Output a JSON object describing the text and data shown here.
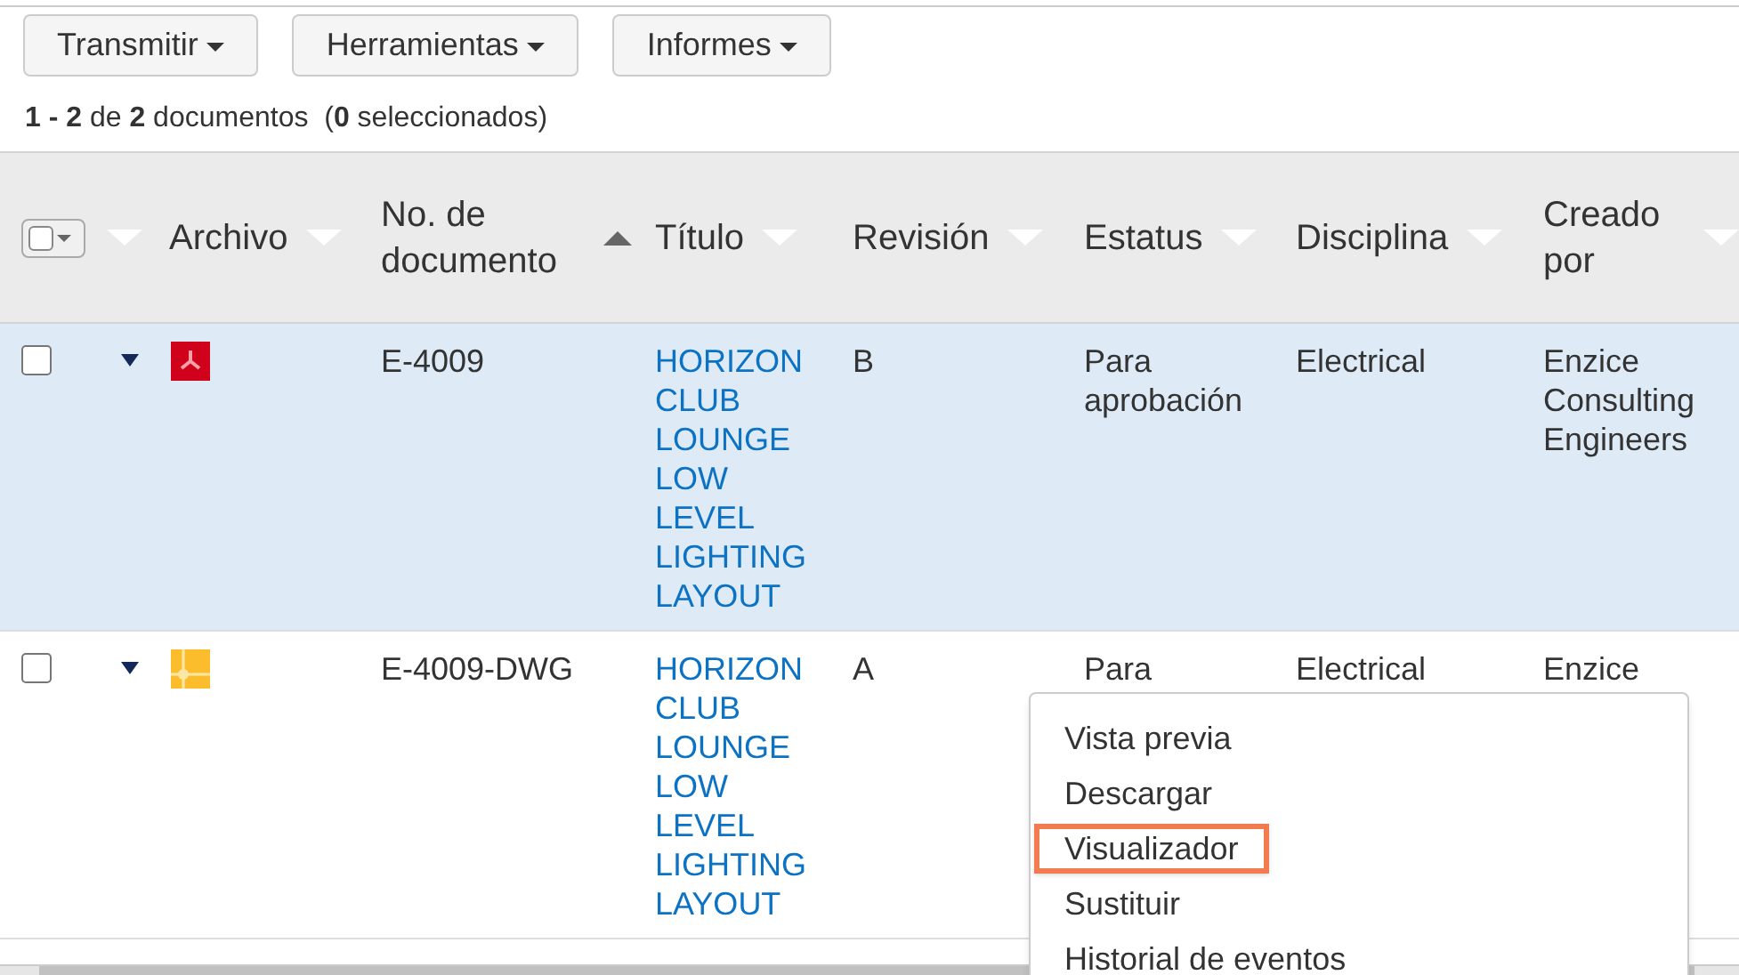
{
  "toolbar": [
    {
      "label": "Transmitir"
    },
    {
      "label": "Herramientas"
    },
    {
      "label": "Informes"
    }
  ],
  "summary": "**1 - 2** de **2** documentos  (**0** seleccionados)",
  "columns": [
    {
      "label": "Archivo",
      "sorted": false
    },
    {
      "label": "No. de documento",
      "sorted": true
    },
    {
      "label": "Título",
      "sorted": false
    },
    {
      "label": "Revisión",
      "sorted": false
    },
    {
      "label": "Estatus",
      "sorted": false
    },
    {
      "label": "Disciplina",
      "sorted": false
    },
    {
      "label": "Creado por",
      "sorted": false
    }
  ],
  "rows": [
    {
      "selected": true,
      "checked": false,
      "kind": "pdf",
      "number": "E-4009",
      "title": "HORIZON CLUB LOUNGE LOW LEVEL LIGHTING LAYOUT",
      "revision": "B",
      "status": "Para aprobación",
      "discipline": "Electrical",
      "created_by": "Enzice Consulting Engineers"
    },
    {
      "selected": false,
      "checked": false,
      "kind": "dwg",
      "number": "E-4009-DWG",
      "title": "HORIZON CLUB LOUNGE LOW LEVEL LIGHTING LAYOUT",
      "revision": "A",
      "status": "Para",
      "discipline": "Electrical",
      "created_by": "Enzice"
    }
  ],
  "context_menu": [
    {
      "label": "Vista previa",
      "selected": false
    },
    {
      "label": "Descargar",
      "selected": false
    },
    {
      "label": "Visualizador",
      "selected": true
    },
    {
      "label": "Sustituir",
      "selected": false
    },
    {
      "label": "Historial de eventos",
      "selected": false
    }
  ]
}
